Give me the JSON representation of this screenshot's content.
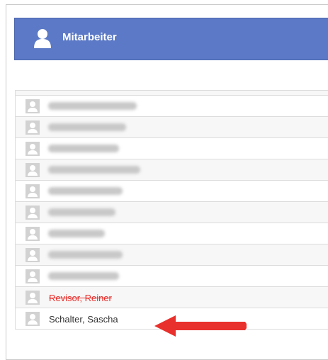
{
  "header": {
    "title": "Mitarbeiter",
    "icon": "user-icon"
  },
  "list": {
    "rows": [
      {
        "name": "",
        "redacted": true,
        "blur_width": 120
      },
      {
        "name": "",
        "redacted": true,
        "blur_width": 110
      },
      {
        "name": "",
        "redacted": true,
        "blur_width": 100
      },
      {
        "name": "",
        "redacted": true,
        "blur_width": 130
      },
      {
        "name": "",
        "redacted": true,
        "blur_width": 105
      },
      {
        "name": "",
        "redacted": true,
        "blur_width": 95
      },
      {
        "name": "",
        "redacted": true,
        "blur_width": 80
      },
      {
        "name": "",
        "redacted": true,
        "blur_width": 100
      },
      {
        "name": "Revisor, Reiner",
        "redacted": false,
        "strikethrough": true
      },
      {
        "name": "Schalter, Sascha",
        "redacted": false,
        "strikethrough": false
      }
    ]
  },
  "colors": {
    "header_bg": "#5b79c6",
    "arrow": "#e8302c",
    "strike_text": "#e8302c"
  }
}
